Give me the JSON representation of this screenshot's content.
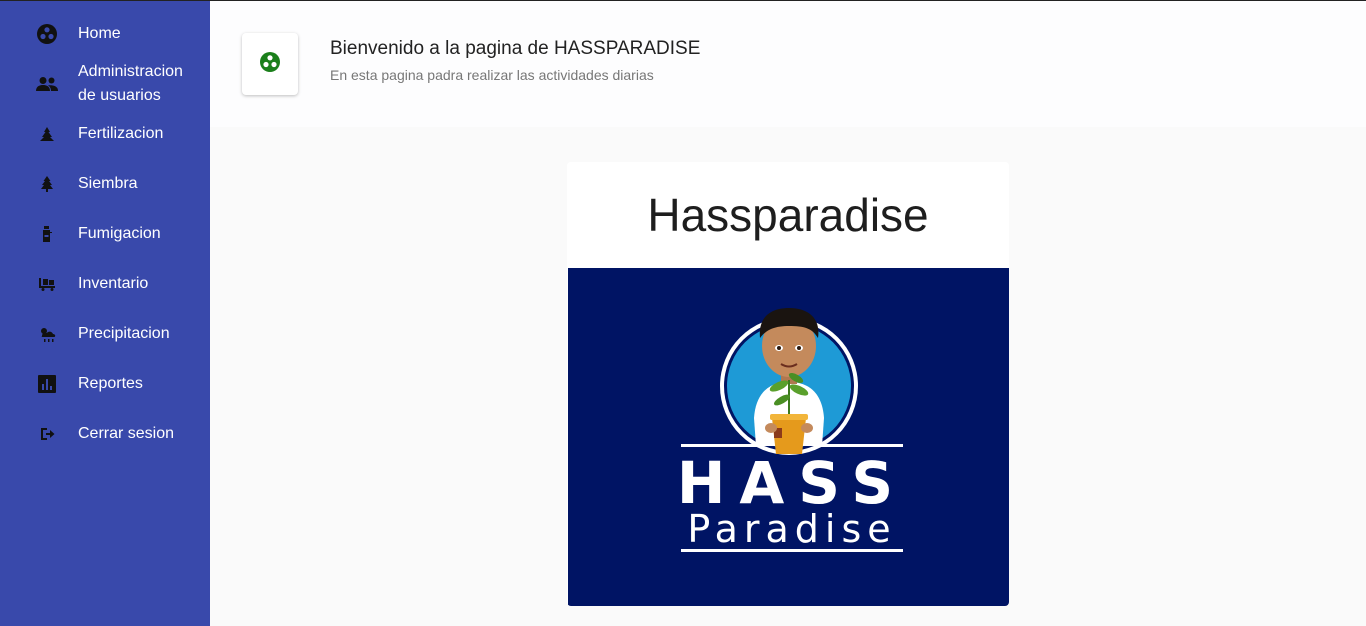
{
  "sidebar": {
    "items": [
      {
        "label": "Home",
        "icon": "home-icon"
      },
      {
        "label": "Administracion de usuarios",
        "icon": "users-icon"
      },
      {
        "label": "Fertilizacion",
        "icon": "fertilizer-icon"
      },
      {
        "label": "Siembra",
        "icon": "tree-icon"
      },
      {
        "label": "Fumigacion",
        "icon": "spray-icon"
      },
      {
        "label": "Inventario",
        "icon": "inventory-icon"
      },
      {
        "label": "Precipitacion",
        "icon": "weather-icon"
      },
      {
        "label": "Reportes",
        "icon": "chart-icon"
      },
      {
        "label": "Cerrar sesion",
        "icon": "logout-icon"
      }
    ]
  },
  "header": {
    "title": "Bienvenido a la pagina de HASSPARADISE",
    "subtitle": "En esta pagina padra realizar las actividades diarias",
    "icon": "bubble-chart-icon",
    "icon_color": "#1b7f1b"
  },
  "card": {
    "title": "Hassparadise",
    "logo": {
      "line1": "HASS",
      "line2": "Paradise",
      "background": "#001464"
    }
  },
  "colors": {
    "sidebar": "#3949ab",
    "page_bg": "#fafafa"
  }
}
